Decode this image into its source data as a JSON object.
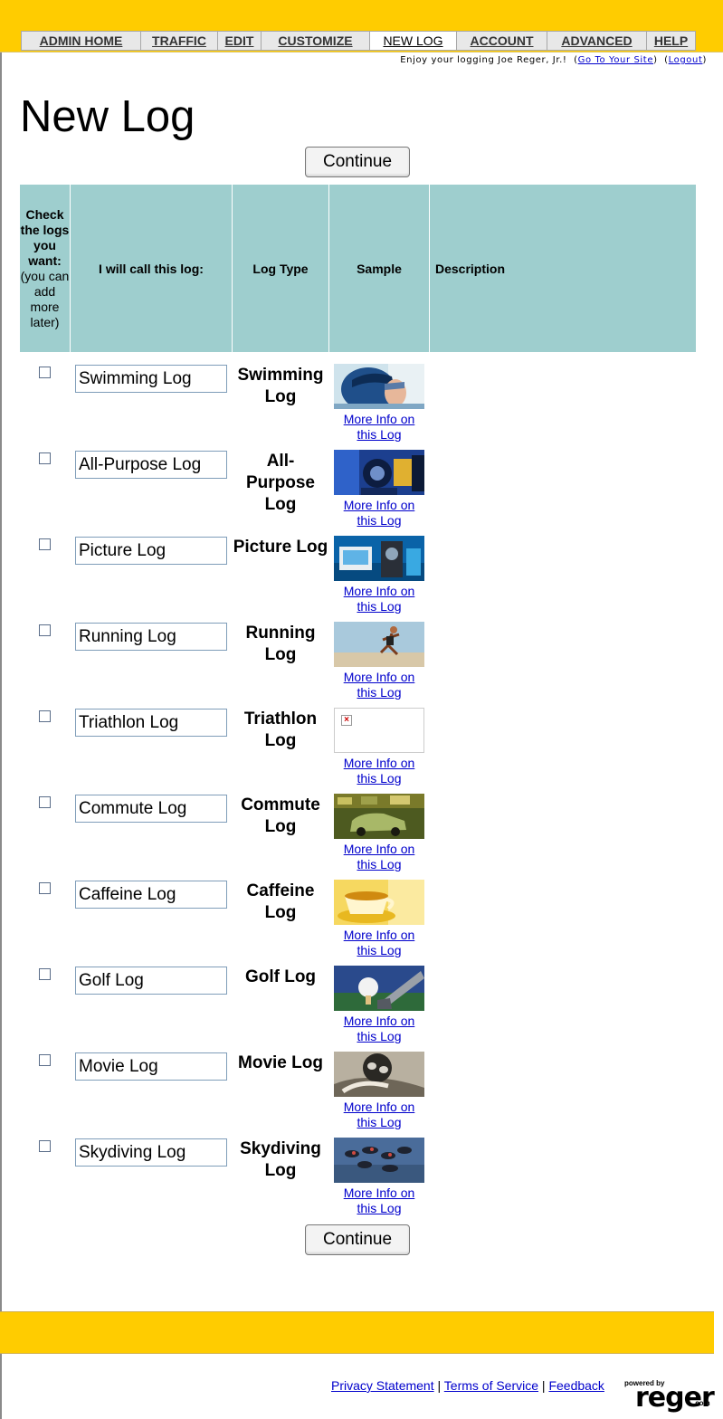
{
  "nav": {
    "tabs": [
      {
        "label": "ADMIN HOME",
        "active": false
      },
      {
        "label": "TRAFFIC",
        "active": false
      },
      {
        "label": "EDIT",
        "active": false
      },
      {
        "label": "CUSTOMIZE",
        "active": false
      },
      {
        "label": "NEW LOG",
        "active": true
      },
      {
        "label": "ACCOUNT",
        "active": false
      },
      {
        "label": "ADVANCED",
        "active": false
      },
      {
        "label": "HELP",
        "active": false
      }
    ]
  },
  "greeting": {
    "text": "Enjoy your logging Joe Reger, Jr.!",
    "site_link": "Go To Your Site",
    "logout_link": "Logout"
  },
  "page": {
    "title": "New Log",
    "continue_label": "Continue"
  },
  "table": {
    "headers": {
      "check_bold": "Check the logs you want:",
      "check_note": "(you can add more later)",
      "name": "I will call this log:",
      "type": "Log Type",
      "sample": "Sample",
      "description": "Description"
    },
    "more_info_label": "More Info on this Log",
    "rows": [
      {
        "name": "Swimming Log",
        "type": "Swimming Log",
        "sample_icon": "swimmer-photo-icon"
      },
      {
        "name": "All-Purpose Log",
        "type": "All-Purpose Log",
        "sample_icon": "machinery-photo-icon"
      },
      {
        "name": "Picture Log",
        "type": "Picture Log",
        "sample_icon": "camera-photo-icon"
      },
      {
        "name": "Running Log",
        "type": "Running Log",
        "sample_icon": "runner-photo-icon"
      },
      {
        "name": "Triathlon Log",
        "type": "Triathlon Log",
        "sample_icon": "broken-image-icon"
      },
      {
        "name": "Commute Log",
        "type": "Commute Log",
        "sample_icon": "car-photo-icon"
      },
      {
        "name": "Caffeine Log",
        "type": "Caffeine Log",
        "sample_icon": "coffee-cup-photo-icon"
      },
      {
        "name": "Golf Log",
        "type": "Golf Log",
        "sample_icon": "golf-ball-photo-icon"
      },
      {
        "name": "Movie Log",
        "type": "Movie Log",
        "sample_icon": "film-reel-photo-icon"
      },
      {
        "name": "Skydiving Log",
        "type": "Skydiving Log",
        "sample_icon": "skydivers-photo-icon"
      }
    ]
  },
  "footer": {
    "links": [
      "Privacy Statement",
      "Terms of Service",
      "Feedback"
    ],
    "logo_small": "powered by",
    "logo_main": "reger",
    "logo_suffix": ".com"
  },
  "colors": {
    "topbar": "#ffcc00",
    "table_header": "#9ecece",
    "link": "#0000cc"
  }
}
